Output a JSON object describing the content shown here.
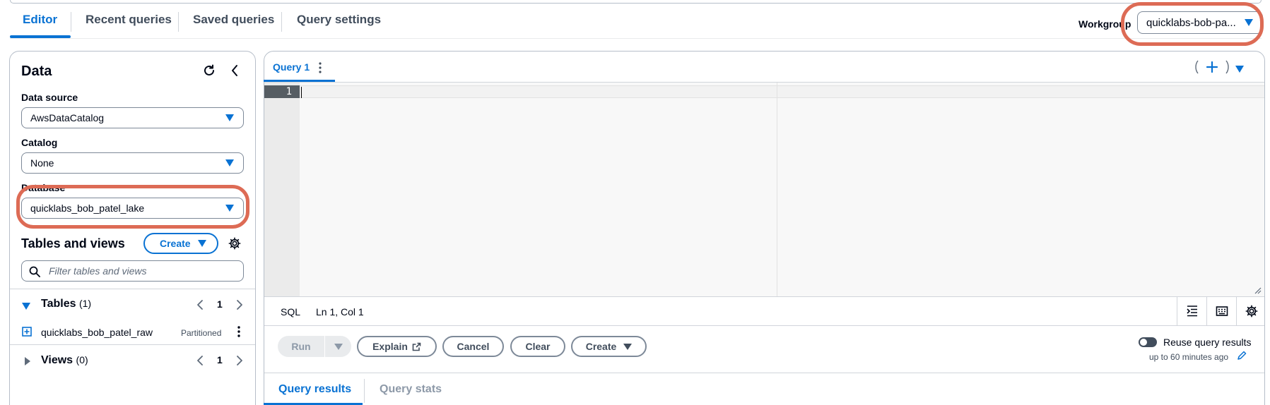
{
  "tabs": [
    {
      "label": "Editor",
      "active": true
    },
    {
      "label": "Recent queries",
      "active": false
    },
    {
      "label": "Saved queries",
      "active": false
    },
    {
      "label": "Query settings",
      "active": false
    }
  ],
  "workgroup": {
    "label": "Workgroup",
    "value": "quicklabs-bob-pa..."
  },
  "data_panel": {
    "title": "Data",
    "data_source": {
      "label": "Data source",
      "value": "AwsDataCatalog"
    },
    "catalog": {
      "label": "Catalog",
      "value": "None"
    },
    "database": {
      "label": "Database",
      "value": "quicklabs_bob_patel_lake"
    },
    "tables_and_views": {
      "title": "Tables and views",
      "create_label": "Create",
      "filter_placeholder": "Filter tables and views"
    },
    "tables": {
      "label": "Tables",
      "count": "(1)",
      "page": "1",
      "items": [
        {
          "name": "quicklabs_bob_patel_raw",
          "badge": "Partitioned"
        }
      ]
    },
    "views": {
      "label": "Views",
      "count": "(0)",
      "page": "1"
    }
  },
  "editor": {
    "query_tab": "Query 1",
    "line_number": "1",
    "language": "SQL",
    "cursor_position": "Ln 1, Col 1"
  },
  "actions": {
    "run": "Run",
    "explain": "Explain",
    "cancel": "Cancel",
    "clear": "Clear",
    "create": "Create",
    "reuse_label": "Reuse query results",
    "reuse_sub": "up to 60 minutes ago"
  },
  "results_tabs": [
    {
      "label": "Query results",
      "active": true
    },
    {
      "label": "Query stats",
      "active": false
    }
  ],
  "colors": {
    "accent": "#0972d3",
    "highlight_circle": "#dd6b55",
    "border": "#b6bec9"
  }
}
